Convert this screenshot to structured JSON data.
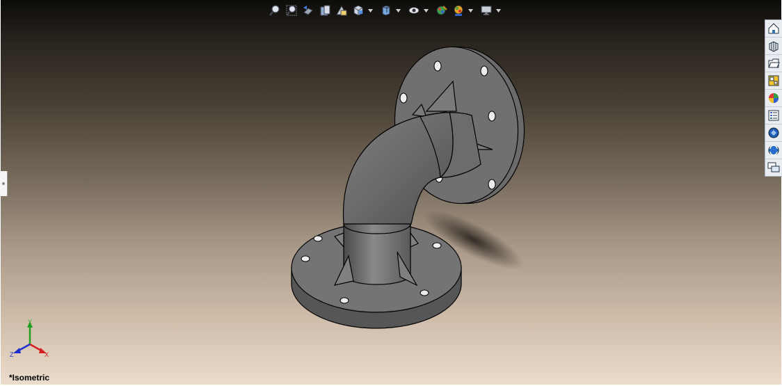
{
  "hud_toolbar": {
    "buttons": [
      {
        "name": "zoom-to-fit-icon"
      },
      {
        "name": "zoom-to-area-icon"
      },
      {
        "name": "previous-view-icon"
      },
      {
        "name": "section-view-icon"
      },
      {
        "name": "dynamic-annotation-icon"
      },
      {
        "name": "view-orientation-icon",
        "dropdown": true
      },
      {
        "name": "display-style-icon",
        "dropdown": true
      },
      {
        "name": "hide-show-items-icon",
        "dropdown": true
      },
      {
        "name": "edit-appearance-icon"
      },
      {
        "name": "apply-scene-icon",
        "dropdown": true
      },
      {
        "name": "view-settings-icon",
        "dropdown": true
      }
    ]
  },
  "task_pane": {
    "tabs": [
      {
        "name": "solidworks-resources-icon"
      },
      {
        "name": "design-library-icon"
      },
      {
        "name": "file-explorer-icon"
      },
      {
        "name": "view-palette-icon"
      },
      {
        "name": "appearances-scenes-icon"
      },
      {
        "name": "custom-properties-icon"
      },
      {
        "name": "solidworks-forum-icon"
      },
      {
        "name": "3d-content-central-icon"
      },
      {
        "name": "discussion-icon"
      }
    ]
  },
  "triad": {
    "x_label": "X",
    "y_label": "Y",
    "z_label": "Z",
    "x_color": "#d42020",
    "y_color": "#20a020",
    "z_color": "#2030d0"
  },
  "view": {
    "name": "*Isometric"
  },
  "colors": {
    "model_face": "#6e6e6e",
    "model_edge": "#000000"
  }
}
